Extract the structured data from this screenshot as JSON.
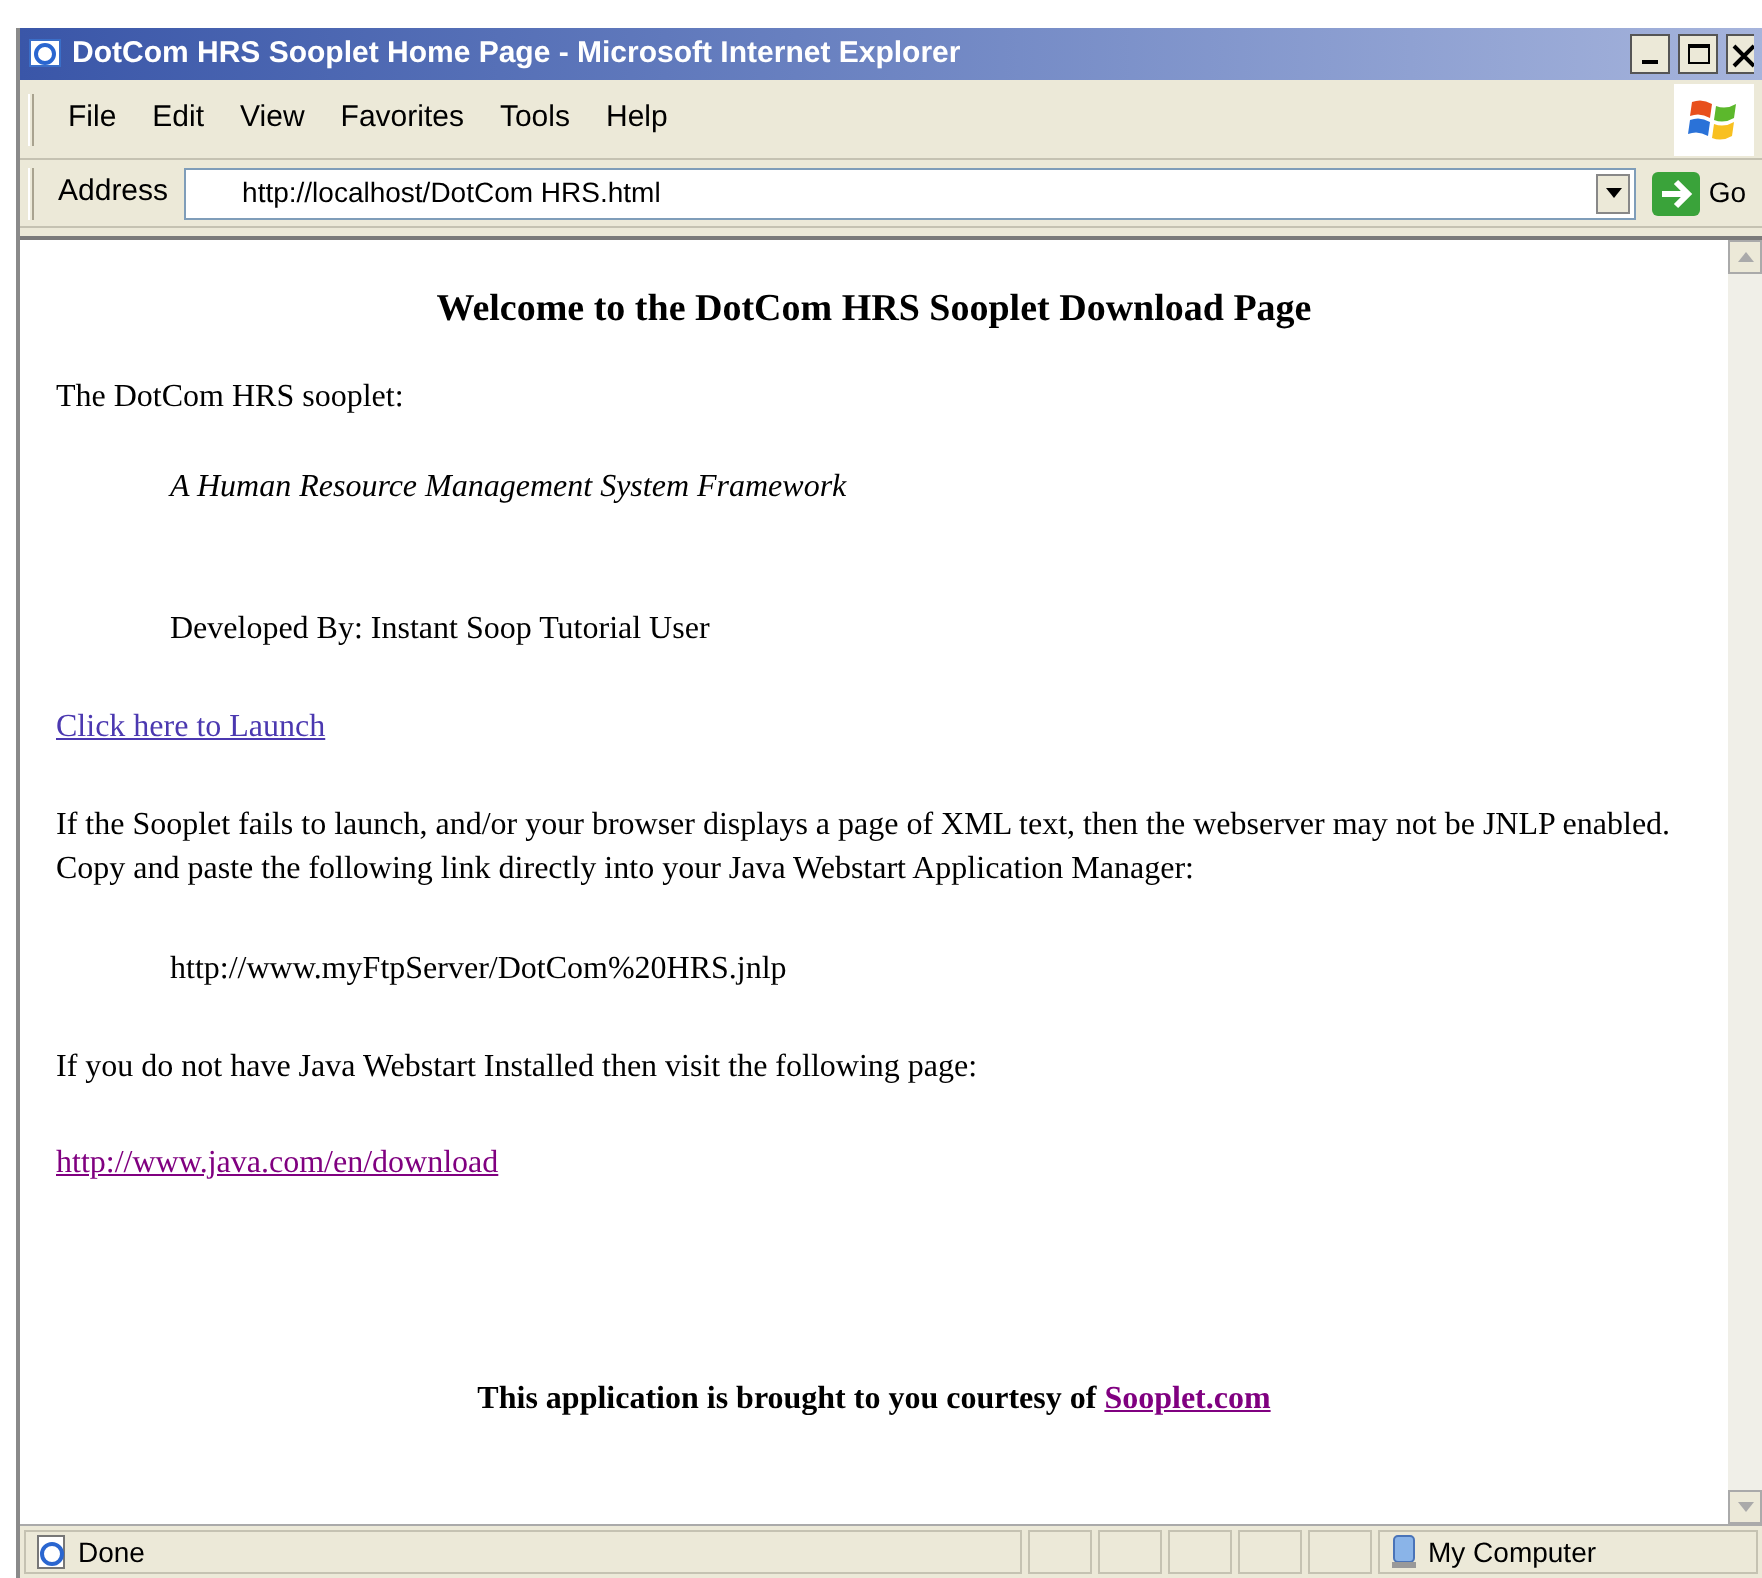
{
  "window": {
    "title": "DotCom HRS Sooplet Home Page - Microsoft Internet Explorer"
  },
  "menu": [
    "File",
    "Edit",
    "View",
    "Favorites",
    "Tools",
    "Help"
  ],
  "address_bar": {
    "label": "Address",
    "value": "http://localhost/DotCom HRS.html",
    "go": "Go"
  },
  "page": {
    "heading": "Welcome to the DotCom HRS Sooplet Download Page",
    "intro": "The DotCom HRS sooplet:",
    "subtitle": "A Human Resource Management System Framework",
    "developer": "Developed By: Instant Soop Tutorial User",
    "launch_link": "Click here to Launch",
    "notice": "If the Sooplet fails to launch, and/or your browser displays a page of XML text, then the webserver may not be JNLP enabled. Copy and paste the following link directly into your Java Webstart Application Manager:",
    "jnlp_url": "http://www.myFtpServer/DotCom%20HRS.jnlp",
    "java_notice": "If you do not have Java Webstart Installed then visit the following page:",
    "java_link": "http://www.java.com/en/download",
    "footer": "This application is brought to you courtesy of ",
    "footer_link": "Sooplet.com"
  },
  "status_bar": {
    "status": "Done",
    "zone": "My Computer"
  }
}
